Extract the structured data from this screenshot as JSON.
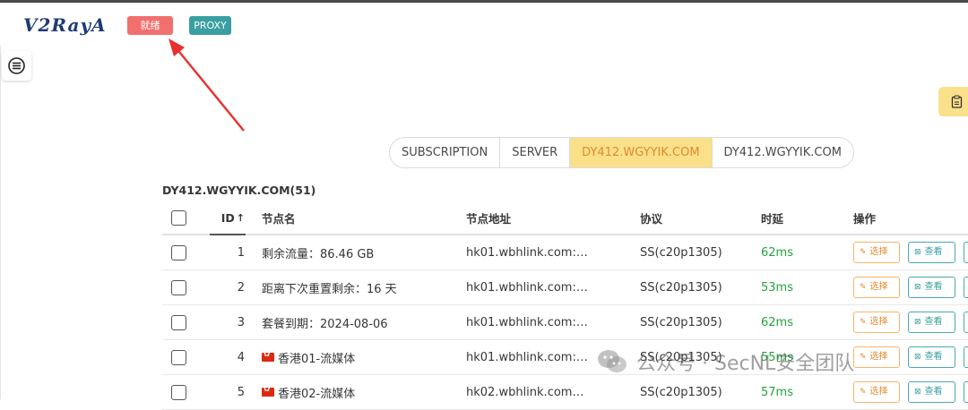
{
  "app": {
    "logo": "V2RayA"
  },
  "header": {
    "status_tag": "就绪",
    "mode_tag": "PROXY"
  },
  "colors": {
    "accent": "#fbe08a",
    "status_ready": "#f1706e",
    "proxy": "#3b9fa2",
    "latency_ok": "#23a33d"
  },
  "tabs": [
    {
      "label": "SUBSCRIPTION",
      "active": false
    },
    {
      "label": "SERVER",
      "active": false
    },
    {
      "label": "DY412.WGYYIK.COM",
      "active": true
    },
    {
      "label": "DY412.WGYYIK.COM",
      "active": false
    }
  ],
  "group": {
    "title": "DY412.WGYYIK.COM(51)"
  },
  "table": {
    "headers": {
      "id": "ID",
      "sort_arrow": "↑",
      "name": "节点名",
      "address": "节点地址",
      "protocol": "协议",
      "latency": "时延",
      "ops": "操作"
    },
    "rows": [
      {
        "id": "1",
        "name": "剩余流量：86.46 GB",
        "flag": false,
        "address": "hk01.wbhlink.com:…",
        "protocol": "SS(c20p1305)",
        "latency": "62ms"
      },
      {
        "id": "2",
        "name": "距离下次重置剩余：16 天",
        "flag": false,
        "address": "hk01.wbhlink.com:…",
        "protocol": "SS(c20p1305)",
        "latency": "53ms"
      },
      {
        "id": "3",
        "name": "套餐到期：2024-08-06",
        "flag": false,
        "address": "hk01.wbhlink.com:…",
        "protocol": "SS(c20p1305)",
        "latency": "62ms"
      },
      {
        "id": "4",
        "name": "香港01-流媒体",
        "flag": true,
        "address": "hk01.wbhlink.com:…",
        "protocol": "SS(c20p1305)",
        "latency": "55ms"
      },
      {
        "id": "5",
        "name": "香港02-流媒体",
        "flag": true,
        "address": "hk02.wbhlink.com…",
        "protocol": "SS(c20p1305)",
        "latency": "57ms"
      }
    ],
    "op_select": "选择",
    "op_view": "查看"
  },
  "watermark": {
    "text": "公众号 · SecNL安全团队"
  }
}
